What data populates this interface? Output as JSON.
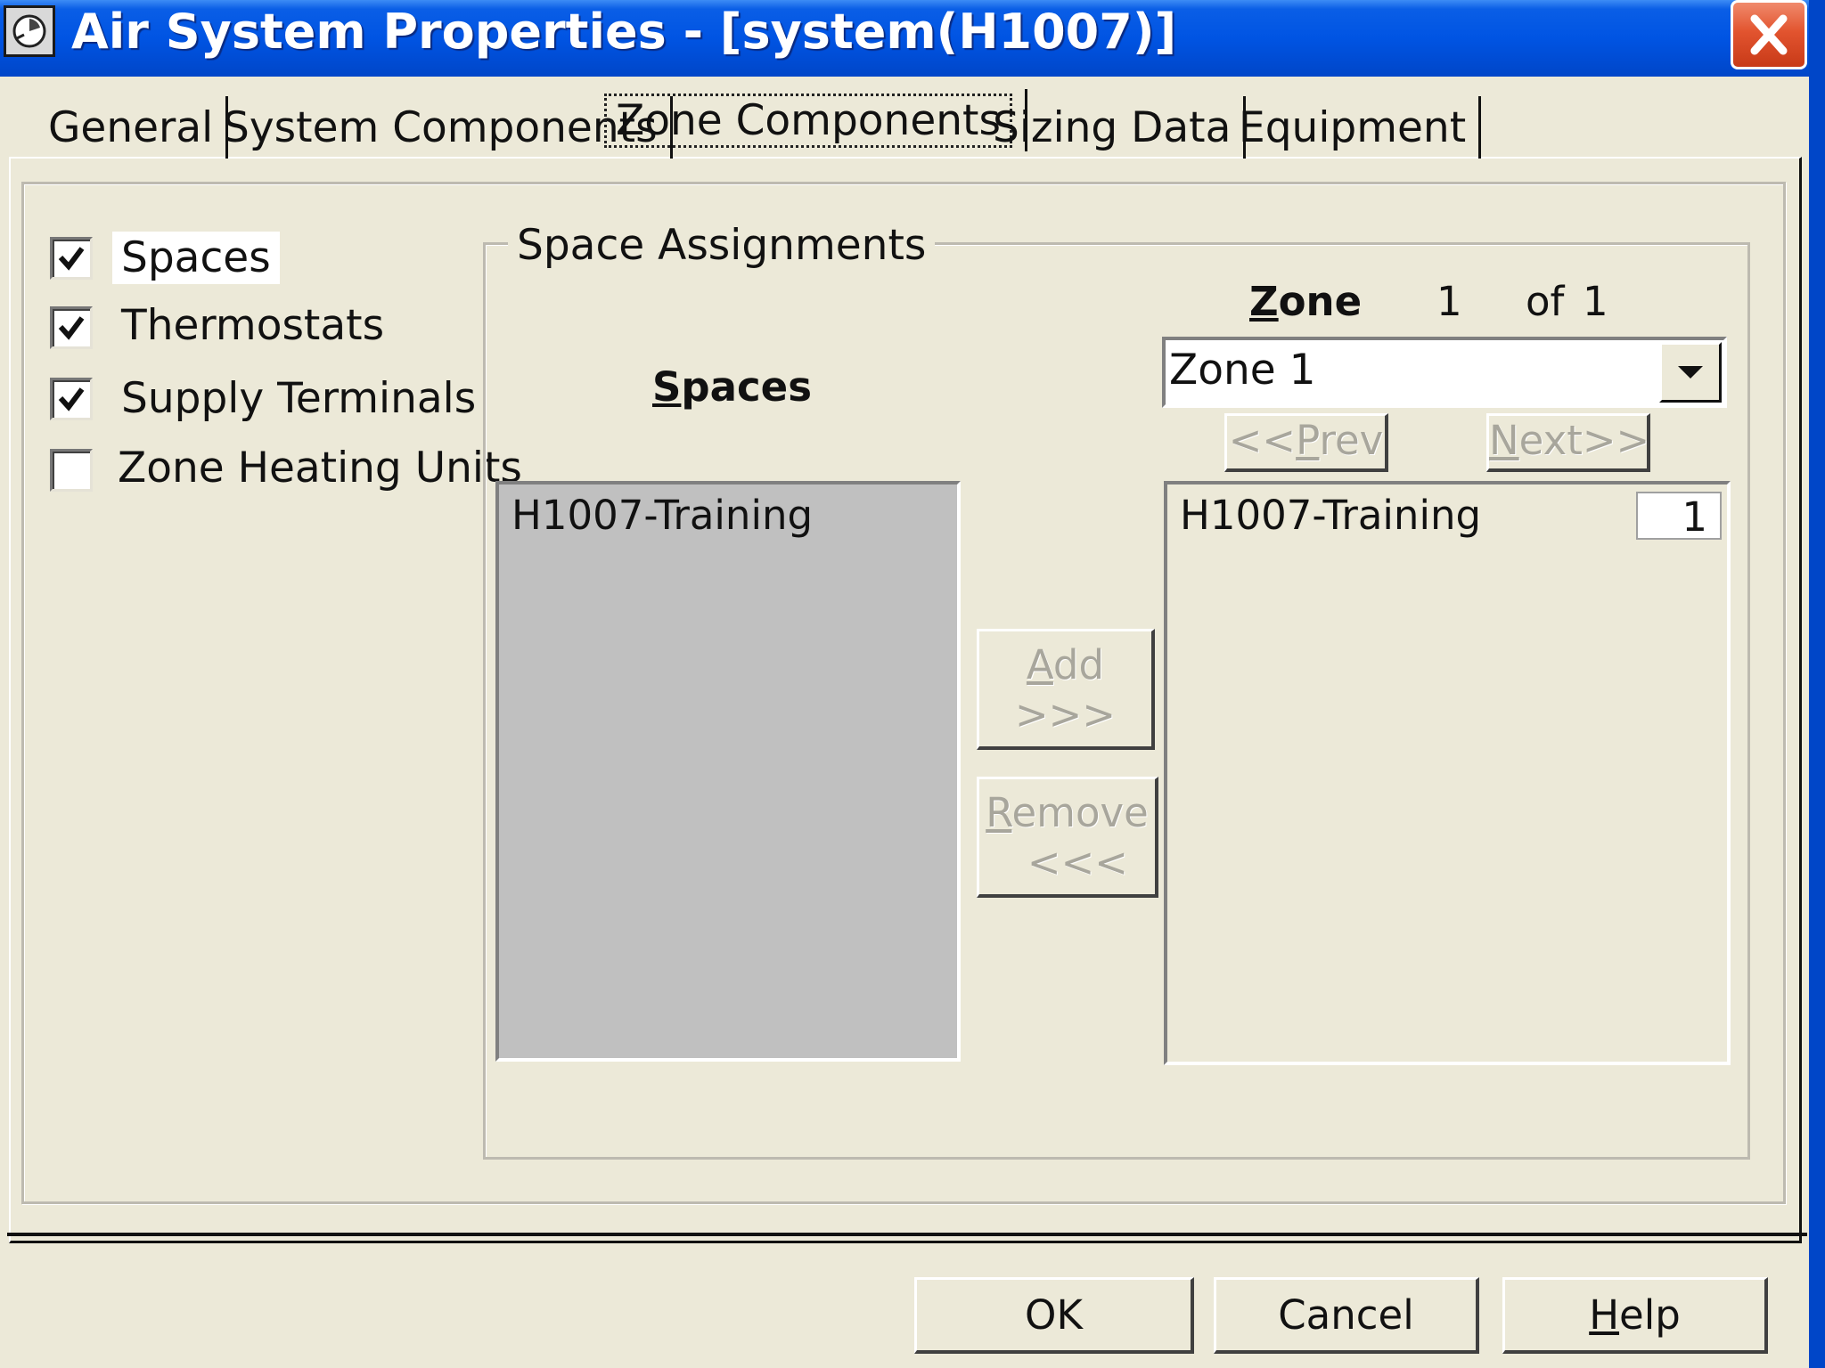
{
  "window": {
    "title": "Air System Properties - [system(H1007)]"
  },
  "tabs": [
    {
      "label": "General"
    },
    {
      "label": "System Components"
    },
    {
      "label": "Zone Components"
    },
    {
      "label": "Sizing Data"
    },
    {
      "label": "Equipment"
    }
  ],
  "checkboxes": [
    {
      "label": "Spaces",
      "checked": true
    },
    {
      "label": "Thermostats",
      "checked": true
    },
    {
      "label": "Supply Terminals",
      "checked": true
    },
    {
      "label": "Zone Heating Units",
      "checked": false
    }
  ],
  "space_assignments": {
    "group_title": "Space Assignments",
    "spaces_heading_first": "S",
    "spaces_heading_rest": "paces",
    "available_spaces": [
      "H1007-Training"
    ],
    "zone_heading_first": "Z",
    "zone_heading_rest": "one",
    "zone_current": "1",
    "zone_of": "of",
    "zone_total": "1",
    "zone_selected": "Zone 1",
    "prev_pre": "<<",
    "prev_key": "P",
    "prev_rest": "rev",
    "next_key": "N",
    "next_rest": "ext>>",
    "add_key": "A",
    "add_rest": "dd",
    "add_arrows": ">>>",
    "remove_key": "R",
    "remove_rest": "emove",
    "remove_arrows": "<<<",
    "assigned_spaces": [
      {
        "name": "H1007-Training",
        "count": "1"
      }
    ]
  },
  "footer": {
    "ok": "OK",
    "cancel": "Cancel",
    "help_key": "H",
    "help_rest": "elp"
  },
  "icons": {
    "app": "air-system-icon",
    "close": "close-icon",
    "dropdown": "chevron-down-icon",
    "check": "check-icon"
  }
}
